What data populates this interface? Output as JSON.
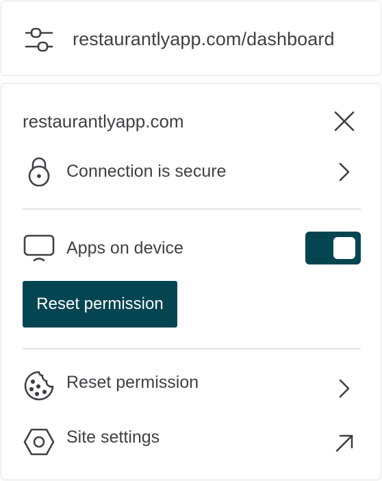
{
  "url_bar": {
    "icon": "tune-icon",
    "url": "restaurantlyapp.com/dashboard"
  },
  "panel": {
    "site": "restaurantlyapp.com",
    "close_icon": "close-icon",
    "connection": {
      "icon": "lock-icon",
      "label": "Connection is secure",
      "trailing_icon": "chevron-right-icon"
    },
    "apps_on_device": {
      "icon": "monitor-icon",
      "label": "Apps on device",
      "toggle_on": true
    },
    "reset_button_label": "Reset permission",
    "cookies": {
      "icon": "cookie-icon",
      "label": "Reset permission",
      "trailing_icon": "chevron-right-icon"
    },
    "site_settings": {
      "icon": "hexagon-settings-icon",
      "label": "Site settings",
      "trailing_icon": "external-arrow-icon"
    }
  },
  "colors": {
    "accent": "#054552",
    "text": "#3f3f46",
    "border": "#e2e2e4"
  }
}
